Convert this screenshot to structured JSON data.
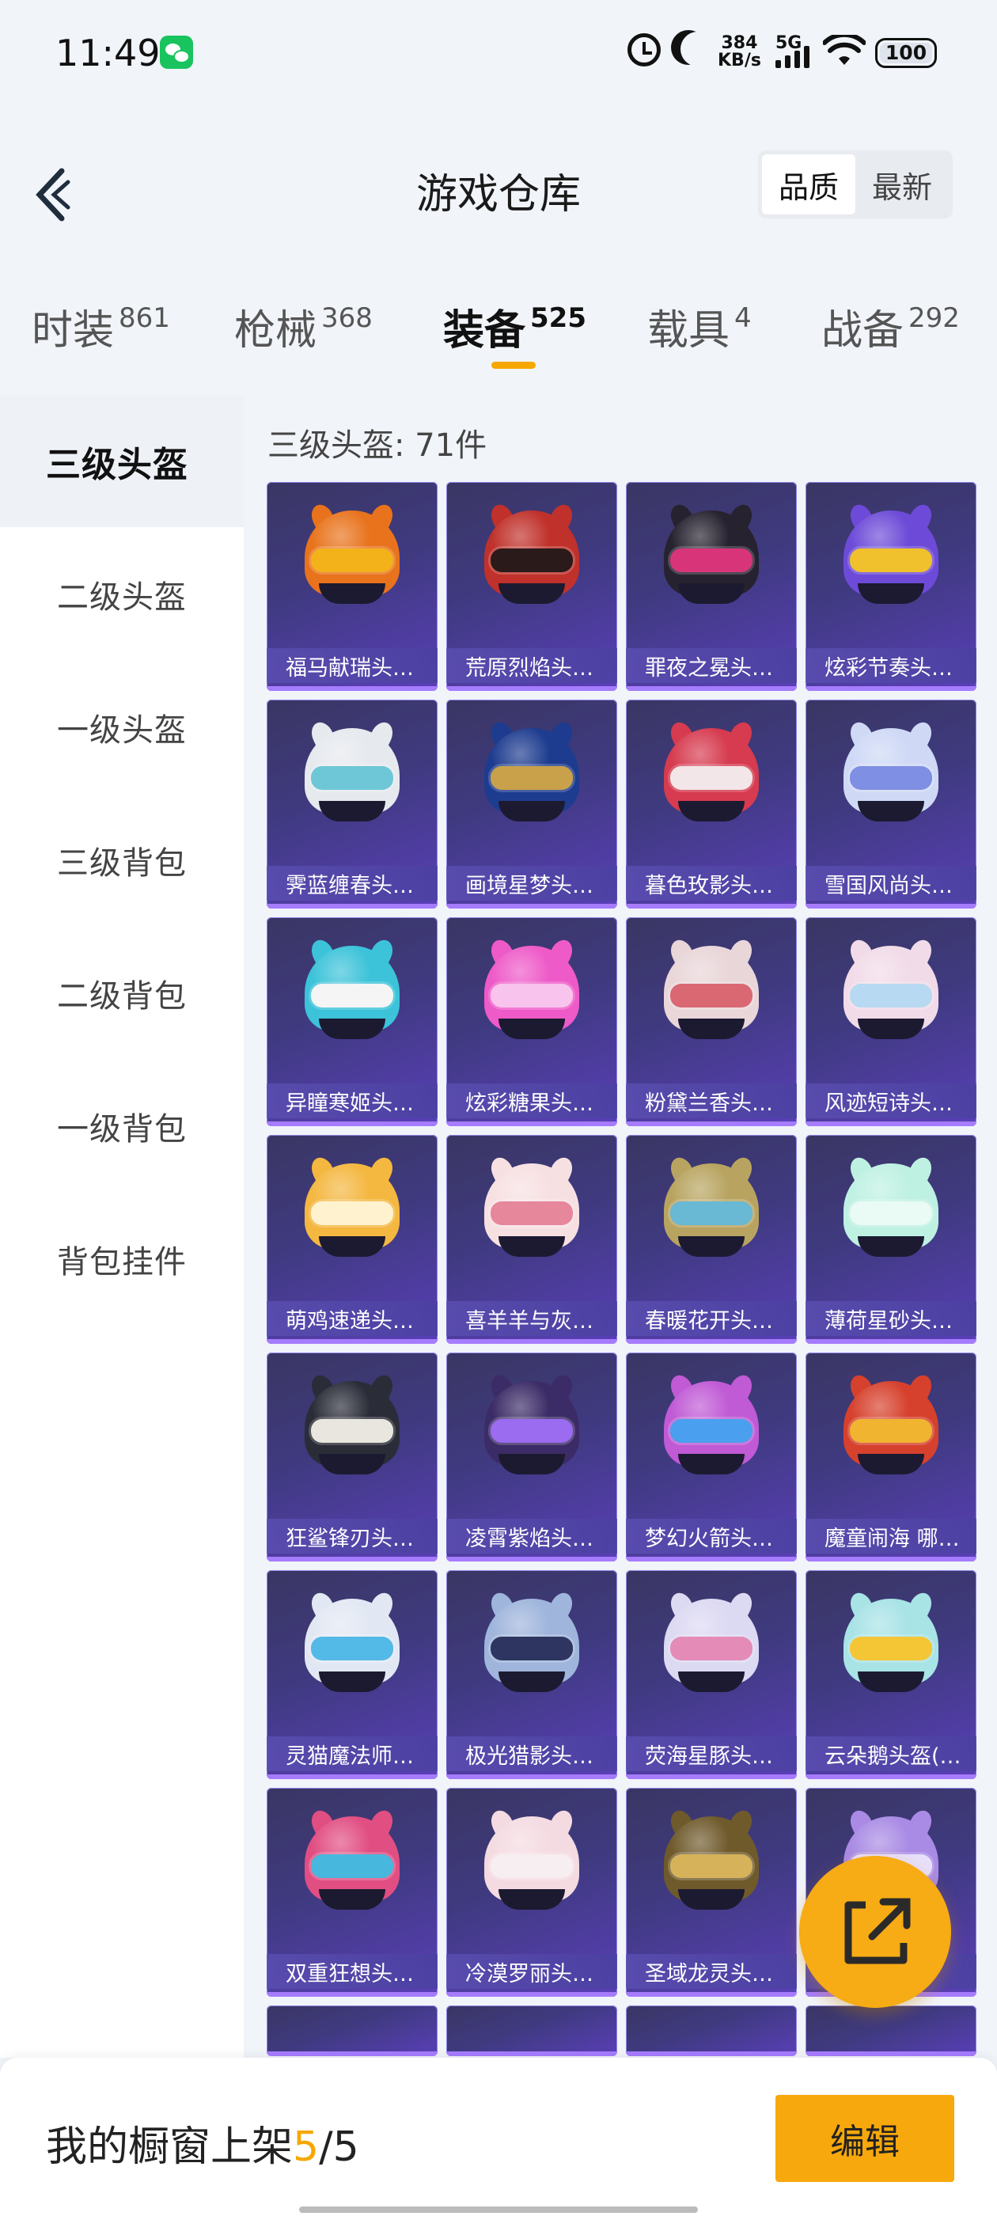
{
  "status_bar": {
    "time": "11:49",
    "speed_value": "384",
    "speed_unit": "KB/s",
    "network": "5G",
    "battery": "100"
  },
  "header": {
    "title": "游戏仓库",
    "sort_options": [
      "品质",
      "最新"
    ]
  },
  "tabs": [
    {
      "label": "时装",
      "count": "861"
    },
    {
      "label": "枪械",
      "count": "368"
    },
    {
      "label": "装备",
      "count": "525"
    },
    {
      "label": "载具",
      "count": "4"
    },
    {
      "label": "战备",
      "count": "292"
    }
  ],
  "sidebar": {
    "items": [
      "三级头盔",
      "二级头盔",
      "一级头盔",
      "三级背包",
      "二级背包",
      "一级背包",
      "背包挂件"
    ]
  },
  "content": {
    "count_label": "三级头盔: 71件"
  },
  "items": [
    {
      "name": "福马献瑞头…",
      "icon": "fox-helmet-icon",
      "c1": "#e8731c",
      "c2": "#f3b21a"
    },
    {
      "name": "荒原烈焰头…",
      "icon": "flame-helmet-icon",
      "c1": "#c0312b",
      "c2": "#2a1a1a"
    },
    {
      "name": "罪夜之冕头…",
      "icon": "dark-helmet-icon",
      "c1": "#26222f",
      "c2": "#d8347a"
    },
    {
      "name": "炫彩节奏头…",
      "icon": "rhythm-helmet-icon",
      "c1": "#6d4bd8",
      "c2": "#f0c02d"
    },
    {
      "name": "霁蓝缠春头…",
      "icon": "blue-spring-helmet-icon",
      "c1": "#e6e9ee",
      "c2": "#6ec7d6"
    },
    {
      "name": "画境星梦头…",
      "icon": "starry-helmet-icon",
      "c1": "#1e3c8f",
      "c2": "#c9a14a"
    },
    {
      "name": "暮色玫影头…",
      "icon": "rose-helmet-icon",
      "c1": "#d63b4f",
      "c2": "#f2e6e8"
    },
    {
      "name": "雪国风尚头…",
      "icon": "snow-helmet-icon",
      "c1": "#cfd9f6",
      "c2": "#7f8fe3"
    },
    {
      "name": "异瞳寒姬头…",
      "icon": "ice-helmet-icon",
      "c1": "#3cc3d9",
      "c2": "#f5f5f5"
    },
    {
      "name": "炫彩糖果头…",
      "icon": "candy-helmet-icon",
      "c1": "#ee5ac8",
      "c2": "#f8c4ee"
    },
    {
      "name": "粉黛兰香头…",
      "icon": "pink-orchid-helmet-icon",
      "c1": "#e9d6d9",
      "c2": "#d96873"
    },
    {
      "name": "风迹短诗头…",
      "icon": "poem-helmet-icon",
      "c1": "#f1dbe8",
      "c2": "#b7d9f1"
    },
    {
      "name": "萌鸡速递头…",
      "icon": "chick-helmet-icon",
      "c1": "#f4b740",
      "c2": "#fff3cf"
    },
    {
      "name": "喜羊羊与灰…",
      "icon": "sheep-helmet-icon",
      "c1": "#f7e0e2",
      "c2": "#e6879b"
    },
    {
      "name": "春暖花开头…",
      "icon": "flower-helmet-icon",
      "c1": "#b8a460",
      "c2": "#69b8d4"
    },
    {
      "name": "薄荷星砂头…",
      "icon": "mint-helmet-icon",
      "c1": "#bff1e3",
      "c2": "#e9fbf4"
    },
    {
      "name": "狂鲨锋刃头…",
      "icon": "shark-helmet-icon",
      "c1": "#2a2c38",
      "c2": "#e8e6df"
    },
    {
      "name": "凌霄紫焰头…",
      "icon": "purple-flame-helmet-icon",
      "c1": "#3b2b66",
      "c2": "#9b6bf0"
    },
    {
      "name": "梦幻火箭头…",
      "icon": "rocket-helmet-icon",
      "c1": "#c05ad5",
      "c2": "#4aa0ef"
    },
    {
      "name": "魔童闹海 哪…",
      "icon": "nezha-helmet-icon",
      "c1": "#d6412d",
      "c2": "#f0b431"
    },
    {
      "name": "灵猫魔法师…",
      "icon": "cat-helmet-icon",
      "c1": "#e2e8f3",
      "c2": "#53b9e6"
    },
    {
      "name": "极光猎影头…",
      "icon": "aurora-helmet-icon",
      "c1": "#9fb5dc",
      "c2": "#2d3560"
    },
    {
      "name": "荧海星豚头…",
      "icon": "dolphin-helmet-icon",
      "c1": "#dcd9f2",
      "c2": "#e58bb8"
    },
    {
      "name": "云朵鹅头盔(…",
      "icon": "goose-helmet-icon",
      "c1": "#a8e3e6",
      "c2": "#f4c636"
    },
    {
      "name": "双重狂想头…",
      "icon": "jester-helmet-icon",
      "c1": "#e14e82",
      "c2": "#48b7de"
    },
    {
      "name": "冷漠罗丽头…",
      "icon": "lolita-helmet-icon",
      "c1": "#f4dbe2",
      "c2": "#f7eef2"
    },
    {
      "name": "圣域龙灵头…",
      "icon": "dragon-helmet-icon",
      "c1": "#6f5a2c",
      "c2": "#d6b25a"
    },
    {
      "name": "",
      "icon": "lavender-helmet-icon",
      "c1": "#a98be5",
      "c2": "#e8e0fb"
    }
  ],
  "bottom_bar": {
    "label": "我的橱窗上架",
    "current": "5",
    "separator": "/",
    "total": "5",
    "edit_label": "编辑"
  }
}
